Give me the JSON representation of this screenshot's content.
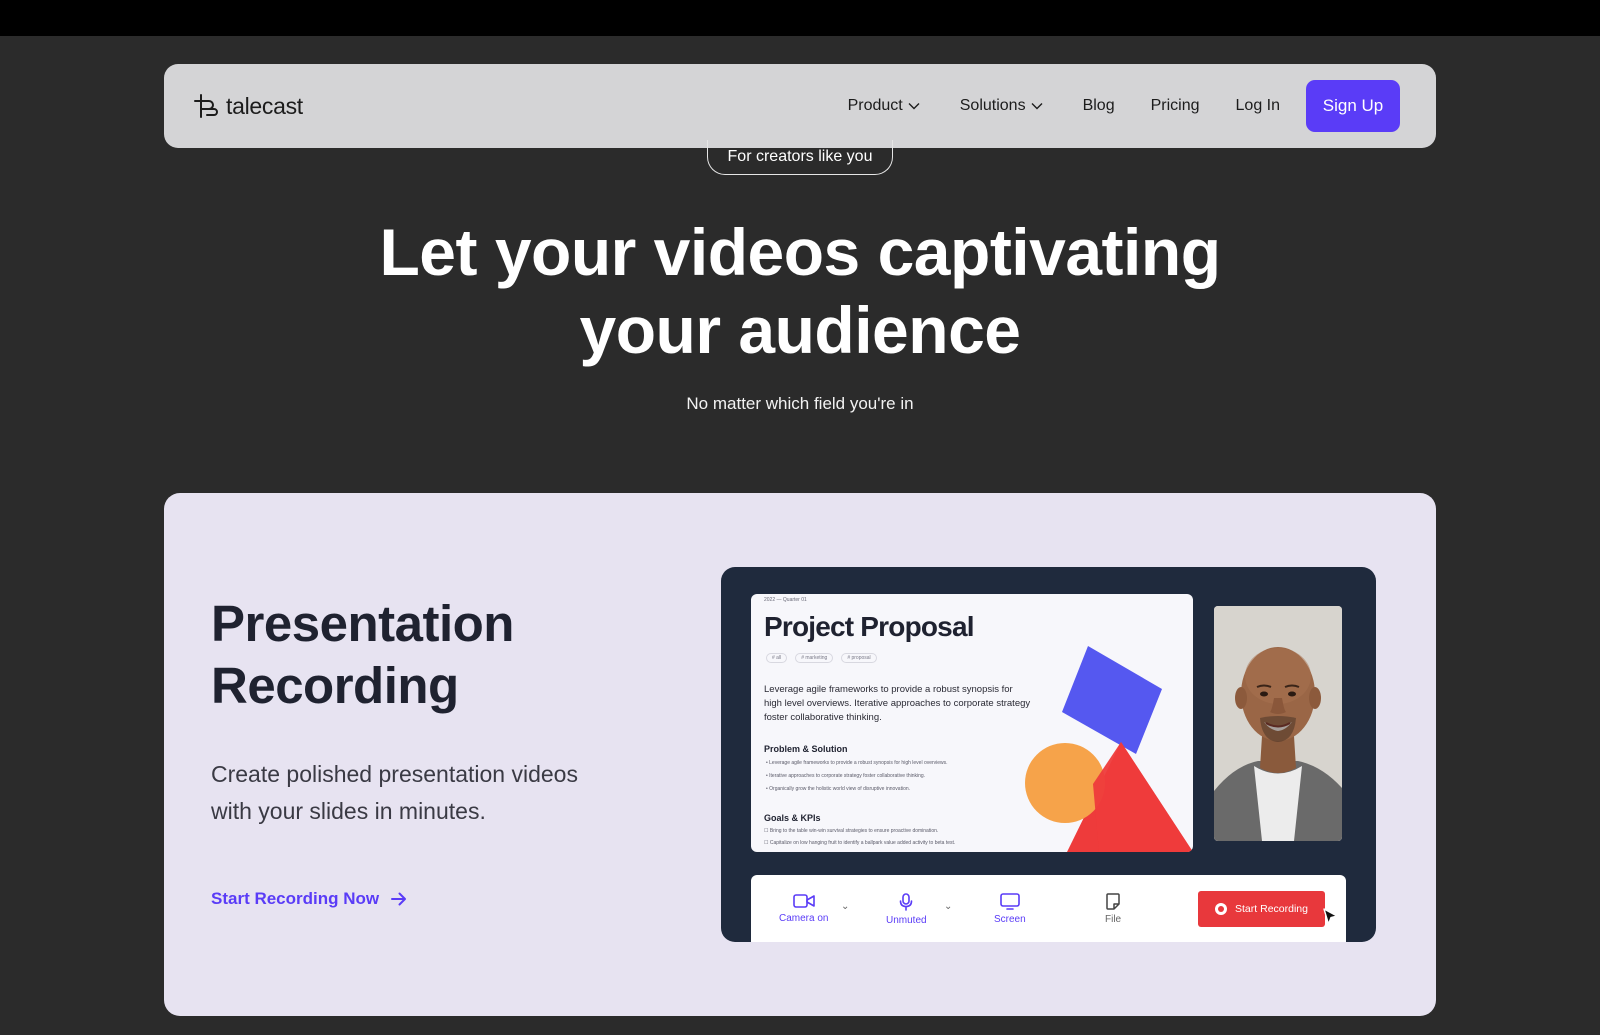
{
  "nav": {
    "brand": "talecast",
    "links": [
      {
        "label": "Product",
        "has_dropdown": true
      },
      {
        "label": "Solutions",
        "has_dropdown": true
      },
      {
        "label": "Blog"
      },
      {
        "label": "Pricing"
      },
      {
        "label": "Log In"
      }
    ],
    "signup_label": "Sign Up"
  },
  "hero": {
    "pill": "For creators like you",
    "title_line1": "Let your videos captivating",
    "title_line2": "your audience",
    "subtitle": "No matter which field you're in"
  },
  "feature": {
    "title_line1": "Presentation",
    "title_line2": "Recording",
    "desc_line1": "Create polished presentation videos",
    "desc_line2": "with your slides in minutes.",
    "cta": "Start Recording Now"
  },
  "slide": {
    "date": "2022 — Quarter 01",
    "title": "Project Proposal",
    "tags": [
      "# all",
      "# marketing",
      "# proposal"
    ],
    "body": "Leverage agile frameworks to provide a robust synopsis for high level overviews. Iterative approaches to corporate strategy foster collaborative thinking.",
    "section1": "Problem & Solution",
    "bullets": [
      "Leverage agile frameworks to provide a robust synopsis for high level overviews.",
      "Iterative approaches to corporate strategy foster collaborative thinking.",
      "Organically grow the holistic world view of disruptive innovation."
    ],
    "section2": "Goals & KPIs",
    "checks": [
      "Bring to the table win-win survival strategies to ensure proactive domination.",
      "Capitalize on low hanging fruit to identify a ballpark value added activity to beta test."
    ]
  },
  "toolbar": {
    "camera": "Camera on",
    "mic": "Unmuted",
    "screen": "Screen",
    "file": "File",
    "record": "Start Recording"
  },
  "colors": {
    "accent": "#5a3cf7",
    "record_red": "#e8383c",
    "page_bg": "#2b2b2b",
    "card_bg": "#e7e3f1"
  }
}
